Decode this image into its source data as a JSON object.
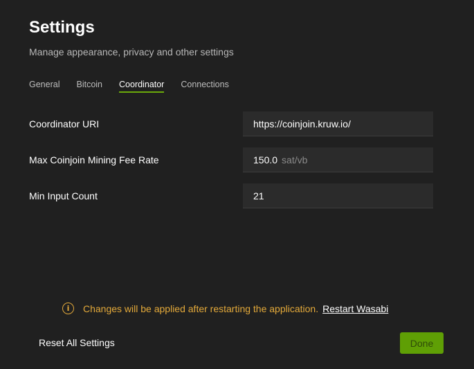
{
  "header": {
    "title": "Settings",
    "subtitle": "Manage appearance, privacy and other settings"
  },
  "tabs": [
    {
      "label": "General",
      "active": false
    },
    {
      "label": "Bitcoin",
      "active": false
    },
    {
      "label": "Coordinator",
      "active": true
    },
    {
      "label": "Connections",
      "active": false
    }
  ],
  "fields": {
    "coordinator_uri": {
      "label": "Coordinator URI",
      "value": "https://coinjoin.kruw.io/"
    },
    "max_fee_rate": {
      "label": "Max Coinjoin Mining Fee Rate",
      "value": "150.0",
      "unit": "sat/vb"
    },
    "min_input_count": {
      "label": "Min Input Count",
      "value": "21"
    }
  },
  "notice": {
    "icon": "info-icon",
    "text": "Changes will be applied after restarting the application.",
    "link_label": "Restart Wasabi"
  },
  "footer": {
    "reset_label": "Reset All Settings",
    "done_label": "Done"
  },
  "colors": {
    "background": "#202020",
    "accent": "#6cab0a",
    "warning": "#e3a93a",
    "done_button": "#5f9f05"
  }
}
